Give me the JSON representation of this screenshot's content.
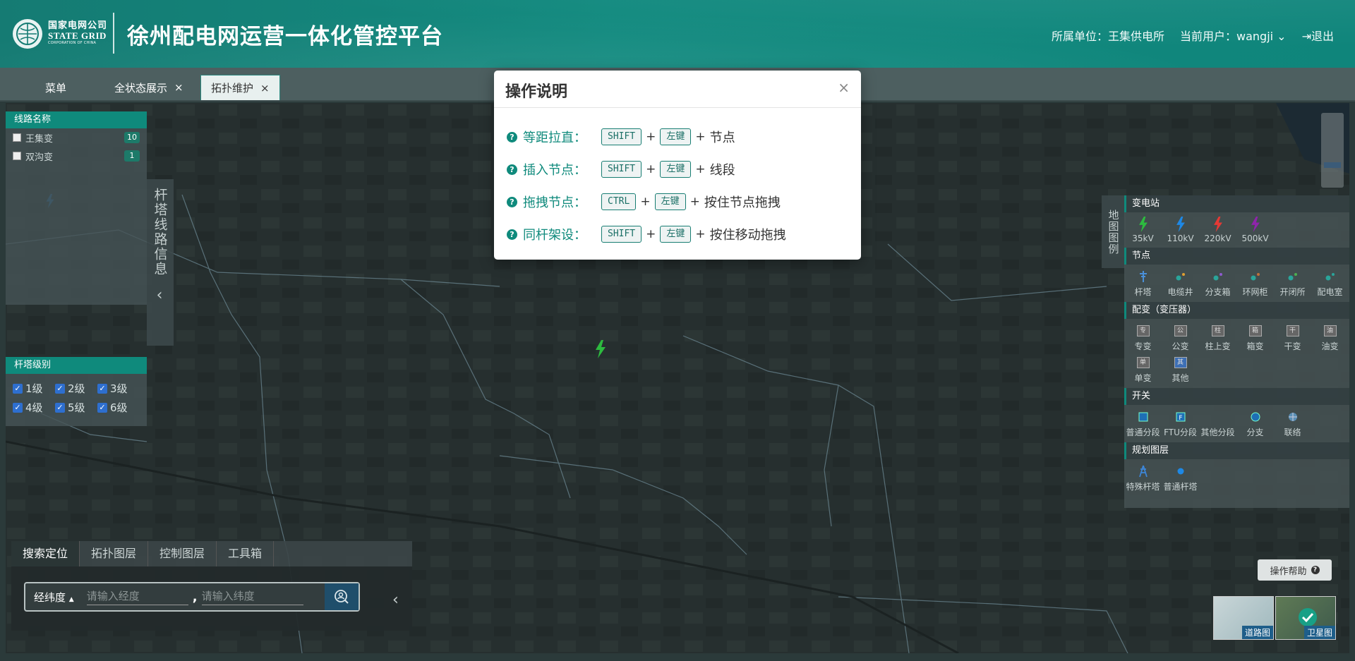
{
  "header": {
    "logo": {
      "cn": "国家电网公司",
      "en": "STATE GRID",
      "sub": "CORPORATION OF CHINA"
    },
    "title": "徐州配电网运营一体化管控平台",
    "unit_label": "所属单位：",
    "unit_value": "王集供电所",
    "user_label": "当前用户：",
    "user_value": "wangji",
    "logout": "退出"
  },
  "tabs": [
    {
      "label": "菜单"
    },
    {
      "label": "全状态展示"
    },
    {
      "label": "拓扑维护"
    }
  ],
  "line_panel": {
    "title": "线路名称",
    "items": [
      {
        "label": "王集变",
        "count": "10"
      },
      {
        "label": "双沟变",
        "count": "1"
      }
    ],
    "side_title": "杆塔线路信息"
  },
  "level_panel": {
    "title": "杆塔级别",
    "levels": [
      "1级",
      "2级",
      "3级",
      "4级",
      "5级",
      "6级"
    ]
  },
  "search": {
    "tabs": [
      "搜索定位",
      "拓扑图层",
      "控制图层",
      "工具箱"
    ],
    "mode": "经纬度",
    "lon_placeholder": "请输入经度",
    "lat_placeholder": "请输入纬度",
    "comma": ","
  },
  "legend": {
    "tag": "地图图例",
    "sections": {
      "substation": {
        "title": "变电站",
        "items": [
          "35kV",
          "110kV",
          "220kV",
          "500kV"
        ],
        "colors": [
          "#2dbb3f",
          "#1e88e5",
          "#e53935",
          "#8e24aa"
        ]
      },
      "node": {
        "title": "节点",
        "items": [
          "杆塔",
          "电缆井",
          "分支箱",
          "环网柜",
          "开闭所",
          "配电室"
        ]
      },
      "transformer": {
        "title": "配变（变压器）",
        "items": [
          "专变",
          "公变",
          "柱上变",
          "箱变",
          "干变",
          "油变",
          "单变",
          "其他"
        ],
        "glyphs": [
          "专",
          "公",
          "柱",
          "箱",
          "干",
          "油",
          "单",
          "其"
        ]
      },
      "switch": {
        "title": "开关",
        "items": [
          "普通分段",
          "FTU分段",
          "其他分段",
          "分支",
          "联络"
        ]
      },
      "plan": {
        "title": "规划图层",
        "items": [
          "特殊杆塔",
          "普通杆塔"
        ]
      }
    }
  },
  "help_button": "操作帮助",
  "map_thumbs": [
    "道路图",
    "卫星图"
  ],
  "modal": {
    "title": "操作说明",
    "rows": [
      {
        "label": "等距拉直：",
        "k1": "SHIFT",
        "k2": "左键",
        "action": "节点"
      },
      {
        "label": "插入节点：",
        "k1": "SHIFT",
        "k2": "左键",
        "action": "线段"
      },
      {
        "label": "拖拽节点：",
        "k1": "CTRL",
        "k2": "左键",
        "action": "按住节点拖拽"
      },
      {
        "label": "同杆架设：",
        "k1": "SHIFT",
        "k2": "左键",
        "action": "按住移动拖拽"
      }
    ]
  }
}
